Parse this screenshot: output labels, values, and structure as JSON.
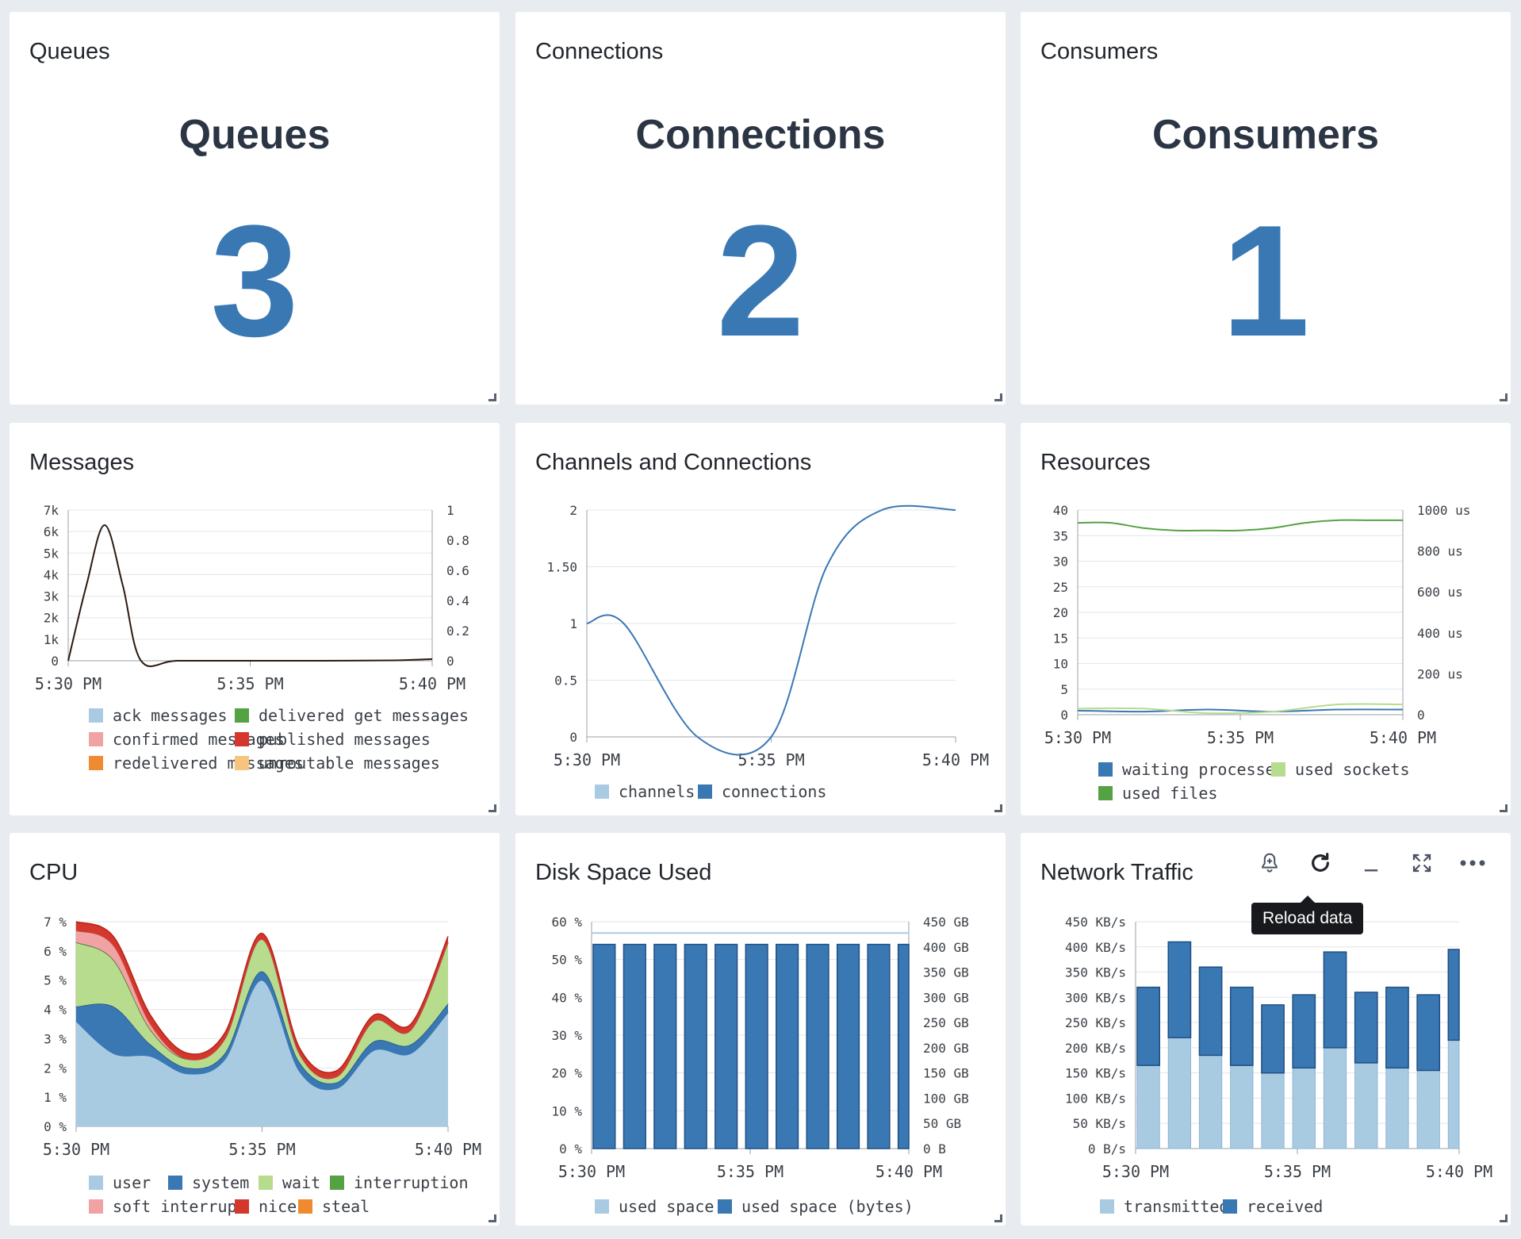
{
  "panels": {
    "queues": {
      "title": "Queues",
      "label": "Queues",
      "value": "3"
    },
    "connections": {
      "title": "Connections",
      "label": "Connections",
      "value": "2"
    },
    "consumers": {
      "title": "Consumers",
      "label": "Consumers",
      "value": "1"
    },
    "messages": {
      "title": "Messages"
    },
    "channels": {
      "title": "Channels and Connections"
    },
    "resources": {
      "title": "Resources"
    },
    "cpu": {
      "title": "CPU"
    },
    "disk": {
      "title": "Disk Space Used"
    },
    "network": {
      "title": "Network Traffic"
    }
  },
  "toolbar": {
    "alert_icon": "bell-plus-icon",
    "reload_icon": "reload-icon",
    "minimize_icon": "minimize-icon",
    "expand_icon": "expand-icon",
    "more_icon": "more-icon",
    "tooltip": "Reload data"
  },
  "colors": {
    "accent": "#3a78b4",
    "light_blue": "#a9cbe2",
    "green": "#55a244",
    "light_green": "#b7dc8e",
    "red": "#d4382c",
    "pink": "#f1a2a2",
    "orange": "#f08a30",
    "light_orange": "#f7c47e"
  },
  "chart_data": [
    {
      "id": "messages",
      "type": "line",
      "x_ticks": [
        "5:30 PM",
        "5:35 PM",
        "5:40 PM"
      ],
      "y_ticks_left": [
        "7k",
        "6k",
        "5k",
        "4k",
        "3k",
        "2k",
        "1k",
        "0"
      ],
      "y_ticks_right": [
        "1",
        "0.8",
        "0.6",
        "0.4",
        "0.2",
        "0"
      ],
      "ylim_left": [
        0,
        7000
      ],
      "ylim_right": [
        0,
        1
      ],
      "series": [
        {
          "name": "ack messages",
          "color": "#a9cbe2"
        },
        {
          "name": "delivered get messages",
          "color": "#55a244"
        },
        {
          "name": "confirmed messages",
          "color": "#f1a2a2"
        },
        {
          "name": "published messages",
          "color": "#d4382c"
        },
        {
          "name": "redelivered messages",
          "color": "#f08a30"
        },
        {
          "name": "unroutable messages",
          "color": "#f7c47e"
        }
      ],
      "x": [
        0,
        0.5,
        1,
        1.5,
        2,
        3,
        5,
        7,
        9,
        10
      ],
      "values": [
        0,
        3500,
        6300,
        3500,
        0,
        0,
        0,
        0,
        20,
        80
      ]
    },
    {
      "id": "channels",
      "type": "line",
      "x_ticks": [
        "5:30 PM",
        "5:35 PM",
        "5:40 PM"
      ],
      "y_ticks": [
        "2",
        "1.50",
        "1",
        "0.5",
        "0"
      ],
      "ylim": [
        0,
        2
      ],
      "series": [
        {
          "name": "channels",
          "color": "#a9cbe2"
        },
        {
          "name": "connections",
          "color": "#3a78b4",
          "x": [
            0,
            1,
            3,
            5,
            6.5,
            8,
            10
          ],
          "values": [
            1,
            1,
            0,
            0,
            1.5,
            2,
            2
          ]
        }
      ]
    },
    {
      "id": "resources",
      "type": "line",
      "x_ticks": [
        "5:30 PM",
        "5:35 PM",
        "5:40 PM"
      ],
      "y_ticks_left": [
        "40",
        "35",
        "30",
        "25",
        "20",
        "15",
        "10",
        "5",
        "0"
      ],
      "y_ticks_right": [
        "1000 us",
        "800 us",
        "600 us",
        "400 us",
        "200 us",
        "0"
      ],
      "ylim_left": [
        0,
        40
      ],
      "ylim_right": [
        0,
        1000
      ],
      "series": [
        {
          "name": "waiting processes",
          "color": "#3a78b4",
          "x": [
            0,
            2,
            4,
            6,
            8,
            10
          ],
          "values": [
            0.8,
            0.6,
            1.0,
            0.6,
            1.0,
            1.0
          ]
        },
        {
          "name": "used sockets",
          "color": "#b7dc8e",
          "x": [
            0,
            2,
            4,
            6,
            8,
            10
          ],
          "values": [
            1.2,
            1.2,
            0.3,
            0.6,
            2.0,
            2.0
          ]
        },
        {
          "name": "used files",
          "color": "#55a244",
          "x": [
            0,
            1,
            2,
            3,
            4,
            5,
            6,
            7,
            8,
            9,
            10
          ],
          "values": [
            37.5,
            37.5,
            36.5,
            36,
            36,
            36,
            36.5,
            37.5,
            38,
            38,
            38
          ]
        }
      ]
    },
    {
      "id": "cpu",
      "type": "area",
      "x_ticks": [
        "5:30 PM",
        "5:35 PM",
        "5:40 PM"
      ],
      "y_ticks": [
        "7 %",
        "6 %",
        "5 %",
        "4 %",
        "3 %",
        "2 %",
        "1 %",
        "0 %"
      ],
      "ylim": [
        0,
        7
      ],
      "x": [
        0,
        1,
        2,
        3,
        4,
        5,
        6,
        7,
        8,
        9,
        10
      ],
      "series": [
        {
          "name": "user",
          "color": "#a9cbe2",
          "values": [
            3.6,
            2.5,
            2.4,
            1.8,
            2.3,
            5.0,
            1.9,
            1.3,
            2.6,
            2.5,
            3.9
          ]
        },
        {
          "name": "system",
          "color": "#3a78b4",
          "values": [
            0.5,
            1.6,
            0.4,
            0.2,
            0.2,
            0.3,
            0.3,
            0.2,
            0.3,
            0.3,
            0.3
          ]
        },
        {
          "name": "wait",
          "color": "#b7dc8e",
          "values": [
            2.2,
            1.6,
            0.5,
            0.3,
            0.5,
            1.1,
            0.3,
            0.2,
            0.7,
            0.5,
            2.1
          ]
        },
        {
          "name": "interruption",
          "color": "#55a244",
          "values": [
            0,
            0,
            0,
            0,
            0,
            0,
            0,
            0,
            0,
            0,
            0
          ]
        },
        {
          "name": "soft interrupt",
          "color": "#f1a2a2",
          "values": [
            0.4,
            0.5,
            0.2,
            0,
            0,
            0,
            0,
            0,
            0,
            0,
            0
          ]
        },
        {
          "name": "nice",
          "color": "#d4382c",
          "values": [
            0.3,
            0.3,
            0.3,
            0.2,
            0.2,
            0.2,
            0.2,
            0.2,
            0.2,
            0.2,
            0.2
          ]
        },
        {
          "name": "steal",
          "color": "#f08a30",
          "values": [
            0,
            0,
            0,
            0,
            0,
            0,
            0,
            0,
            0,
            0,
            0
          ]
        }
      ]
    },
    {
      "id": "disk",
      "type": "bar",
      "x_ticks": [
        "5:30 PM",
        "5:35 PM",
        "5:40 PM"
      ],
      "y_ticks_left": [
        "60 %",
        "50 %",
        "40 %",
        "30 %",
        "20 %",
        "10 %",
        "0 %"
      ],
      "y_ticks_right": [
        "450 GB",
        "400 GB",
        "350 GB",
        "300 GB",
        "250 GB",
        "200 GB",
        "150 GB",
        "100 GB",
        "50 GB",
        "0 B"
      ],
      "ylim_left": [
        0,
        60
      ],
      "ylim_right": [
        0,
        450
      ],
      "series": [
        {
          "name": "used space",
          "color": "#a9cbe2",
          "values": [
            57,
            57,
            57,
            57,
            57,
            57,
            57,
            57,
            57,
            57,
            57
          ]
        },
        {
          "name": "used space (bytes)",
          "color": "#3a78b4",
          "values": [
            405,
            405,
            405,
            405,
            405,
            405,
            405,
            405,
            405,
            405,
            405
          ]
        }
      ]
    },
    {
      "id": "network",
      "type": "bar",
      "x_ticks": [
        "5:30 PM",
        "5:35 PM",
        "5:40 PM"
      ],
      "y_ticks": [
        "450 KB/s",
        "400 KB/s",
        "350 KB/s",
        "300 KB/s",
        "250 KB/s",
        "200 KB/s",
        "150 KB/s",
        "100 KB/s",
        "50 KB/s",
        "0 B/s"
      ],
      "ylim": [
        0,
        450
      ],
      "series": [
        {
          "name": "transmitted",
          "color": "#a9cbe2",
          "values": [
            165,
            220,
            185,
            165,
            150,
            160,
            200,
            170,
            160,
            155,
            215
          ]
        },
        {
          "name": "received",
          "color": "#3a78b4",
          "values": [
            155,
            190,
            175,
            155,
            135,
            145,
            190,
            140,
            160,
            150,
            180
          ]
        }
      ]
    }
  ]
}
